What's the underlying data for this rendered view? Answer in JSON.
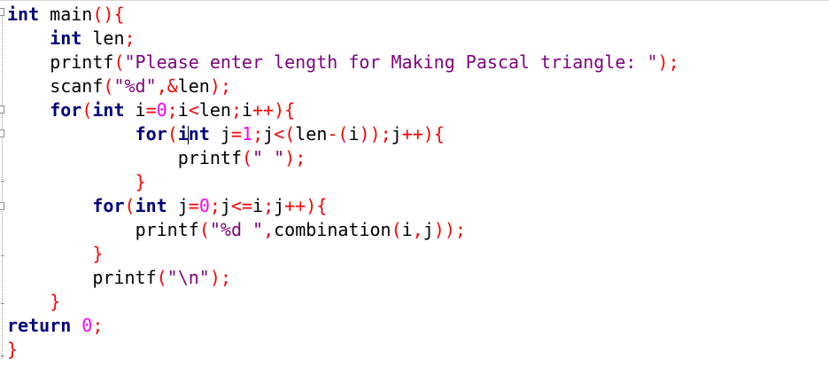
{
  "editor": {
    "language": "C",
    "colors": {
      "keyword": "#00007f",
      "operator": "#ff0000",
      "string": "#7f007f",
      "number": "#ff00ff",
      "text": "#000000"
    },
    "code_lines": [
      "int main(){",
      "    int len;",
      "    printf(\"Please enter length for Making Pascal triangle: \");",
      "    scanf(\"%d\",&len);",
      "    for(int i=0;i<len;i++){",
      "            for(int j=1;j<(len-(i));j++){",
      "                printf(\" \");",
      "            }",
      "        for(int j=0;j<=i;j++){",
      "            printf(\"%d \",combination(i,j));",
      "        }",
      "        printf(\"\\n\");",
      "    }",
      "return 0;",
      "}"
    ],
    "caret": {
      "line": 6,
      "column": 17
    }
  }
}
